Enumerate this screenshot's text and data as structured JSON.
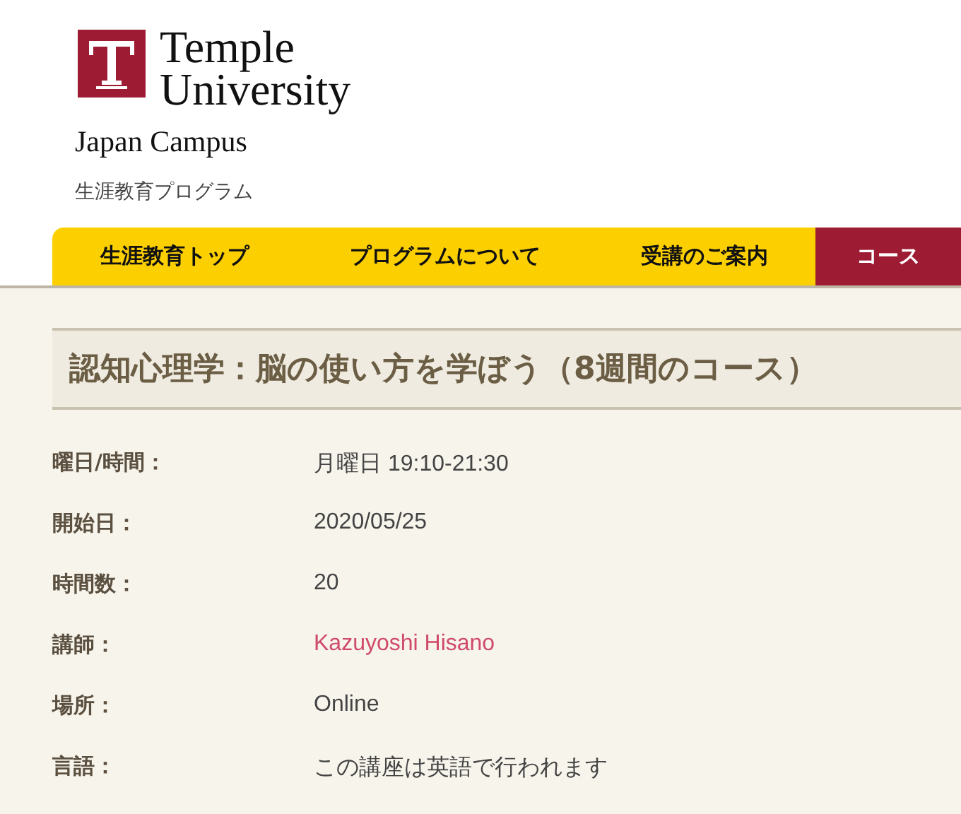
{
  "logo": {
    "line_1": "Temple",
    "line_2": "University",
    "line_3": "Japan Campus"
  },
  "subtitle": "生涯教育プログラム",
  "nav": [
    {
      "label": "生涯教育トップ",
      "selected": false
    },
    {
      "label": "プログラムについて",
      "selected": false
    },
    {
      "label": "受講のご案内",
      "selected": false
    },
    {
      "label": "コース",
      "selected": true
    }
  ],
  "title": "認知心理学：脳の使い方を学ぼう（8週間のコース）",
  "details": [
    {
      "label": "曜日/時間：",
      "value": "月曜日 19:10-21:30",
      "kind": "text"
    },
    {
      "label": "開始日：",
      "value": "2020/05/25",
      "kind": "text"
    },
    {
      "label": "時間数：",
      "value": "20",
      "kind": "text"
    },
    {
      "label": "講師：",
      "value": "Kazuyoshi Hisano",
      "kind": "link"
    },
    {
      "label": "場所：",
      "value": "Online",
      "kind": "text"
    },
    {
      "label": "言語：",
      "value": "この講座は英語で行われます",
      "kind": "text"
    }
  ]
}
